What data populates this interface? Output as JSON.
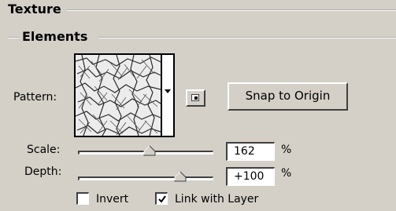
{
  "section": {
    "title": "Texture"
  },
  "subsection": {
    "title": "Elements"
  },
  "pattern": {
    "label": "Pattern:",
    "swatch_icon": "cracked-texture-icon",
    "dropdown_icon": "chevron-down-icon"
  },
  "new_preset_button": {
    "icon": "new-preset-icon"
  },
  "snap_button": {
    "label": "Snap to Origin"
  },
  "scale": {
    "label": "Scale:",
    "value": "162",
    "unit": "%"
  },
  "depth": {
    "label": "Depth:",
    "value": "+100",
    "unit": "%"
  },
  "invert": {
    "label": "Invert",
    "checked": false
  },
  "link_with_layer": {
    "label": "Link with Layer",
    "checked": true
  },
  "colors": {
    "panel": "#d4d0c8",
    "shadow": "#404040",
    "highlight": "#ffffff"
  }
}
